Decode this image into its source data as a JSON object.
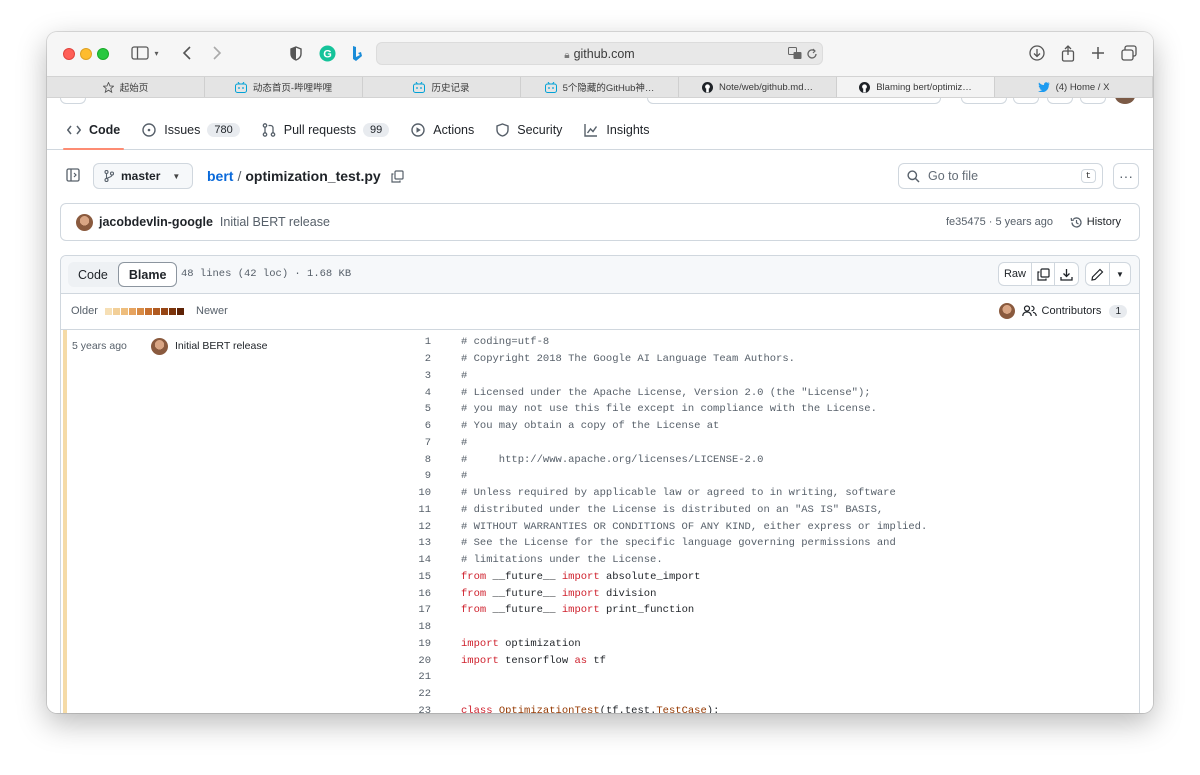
{
  "browser": {
    "url": "github.com",
    "tabs": [
      {
        "label": "起始页",
        "icon": "star-icon"
      },
      {
        "label": "动态首页-哔哩哔哩",
        "icon": "bilibili-icon"
      },
      {
        "label": "历史记录",
        "icon": "bilibili-icon"
      },
      {
        "label": "5个隐藏的GitHub神…",
        "icon": "bilibili-icon"
      },
      {
        "label": "Note/web/github.md…",
        "icon": "github-icon"
      },
      {
        "label": "Blaming bert/optimiz…",
        "icon": "github-icon"
      },
      {
        "label": "(4) Home / X",
        "icon": "twitter-icon"
      }
    ],
    "active_tab": 5
  },
  "repo_nav": {
    "items": [
      {
        "label": "Code",
        "icon": "code-icon"
      },
      {
        "label": "Issues",
        "icon": "issue-icon",
        "count": "780"
      },
      {
        "label": "Pull requests",
        "icon": "pull-request-icon",
        "count": "99"
      },
      {
        "label": "Actions",
        "icon": "play-icon"
      },
      {
        "label": "Security",
        "icon": "shield-icon"
      },
      {
        "label": "Insights",
        "icon": "graph-icon"
      }
    ]
  },
  "file_header": {
    "branch": "master",
    "repo": "bert",
    "separator": "/",
    "file": "optimization_test.py",
    "goto_placeholder": "Go to file",
    "goto_shortcut": "t"
  },
  "commit": {
    "author": "jacobdevlin-google",
    "message": "Initial BERT release",
    "meta": "fe35475 · 5 years ago",
    "history_label": "History"
  },
  "blame": {
    "tab_code": "Code",
    "tab_blame": "Blame",
    "file_info": "48 lines (42 loc) · 1.68 KB",
    "raw_label": "Raw",
    "older_label": "Older",
    "newer_label": "Newer",
    "contributors_label": "Contributors",
    "contributors_count": "1",
    "age_colors": [
      "#f6dfb5",
      "#f2cf98",
      "#eebd7c",
      "#e6a35f",
      "#d88b45",
      "#c7702f",
      "#b05a20",
      "#964514",
      "#7b330b",
      "#5e2205"
    ],
    "group": {
      "age": "5 years ago",
      "message": "Initial BERT release"
    }
  },
  "code_lines": [
    {
      "n": "1",
      "tokens": [
        {
          "t": "# coding=utf-8",
          "c": "c"
        }
      ]
    },
    {
      "n": "2",
      "tokens": [
        {
          "t": "# Copyright 2018 The Google AI Language Team Authors.",
          "c": "c"
        }
      ]
    },
    {
      "n": "3",
      "tokens": [
        {
          "t": "#",
          "c": "c"
        }
      ]
    },
    {
      "n": "4",
      "tokens": [
        {
          "t": "# Licensed under the Apache License, Version 2.0 (the \"License\");",
          "c": "c"
        }
      ]
    },
    {
      "n": "5",
      "tokens": [
        {
          "t": "# you may not use this file except in compliance with the License.",
          "c": "c"
        }
      ]
    },
    {
      "n": "6",
      "tokens": [
        {
          "t": "# You may obtain a copy of the License at",
          "c": "c"
        }
      ]
    },
    {
      "n": "7",
      "tokens": [
        {
          "t": "#",
          "c": "c"
        }
      ]
    },
    {
      "n": "8",
      "tokens": [
        {
          "t": "#     http://www.apache.org/licenses/LICENSE-2.0",
          "c": "c"
        }
      ]
    },
    {
      "n": "9",
      "tokens": [
        {
          "t": "#",
          "c": "c"
        }
      ]
    },
    {
      "n": "10",
      "tokens": [
        {
          "t": "# Unless required by applicable law or agreed to in writing, software",
          "c": "c"
        }
      ]
    },
    {
      "n": "11",
      "tokens": [
        {
          "t": "# distributed under the License is distributed on an \"AS IS\" BASIS,",
          "c": "c"
        }
      ]
    },
    {
      "n": "12",
      "tokens": [
        {
          "t": "# WITHOUT WARRANTIES OR CONDITIONS OF ANY KIND, either express or implied.",
          "c": "c"
        }
      ]
    },
    {
      "n": "13",
      "tokens": [
        {
          "t": "# See the License for the specific language governing permissions and",
          "c": "c"
        }
      ]
    },
    {
      "n": "14",
      "tokens": [
        {
          "t": "# limitations under the License.",
          "c": "c"
        }
      ]
    },
    {
      "n": "15",
      "tokens": [
        {
          "t": "from",
          "c": "k"
        },
        {
          "t": " __future__ ",
          "c": ""
        },
        {
          "t": "import",
          "c": "k"
        },
        {
          "t": " absolute_import",
          "c": ""
        }
      ]
    },
    {
      "n": "16",
      "tokens": [
        {
          "t": "from",
          "c": "k"
        },
        {
          "t": " __future__ ",
          "c": ""
        },
        {
          "t": "import",
          "c": "k"
        },
        {
          "t": " division",
          "c": ""
        }
      ]
    },
    {
      "n": "17",
      "tokens": [
        {
          "t": "from",
          "c": "k"
        },
        {
          "t": " __future__ ",
          "c": ""
        },
        {
          "t": "import",
          "c": "k"
        },
        {
          "t": " print_function",
          "c": ""
        }
      ]
    },
    {
      "n": "18",
      "tokens": []
    },
    {
      "n": "19",
      "tokens": [
        {
          "t": "import",
          "c": "k"
        },
        {
          "t": " optimization",
          "c": ""
        }
      ]
    },
    {
      "n": "20",
      "tokens": [
        {
          "t": "import",
          "c": "k"
        },
        {
          "t": " tensorflow ",
          "c": ""
        },
        {
          "t": "as",
          "c": "k"
        },
        {
          "t": " tf",
          "c": ""
        }
      ]
    },
    {
      "n": "21",
      "tokens": []
    },
    {
      "n": "22",
      "tokens": []
    },
    {
      "n": "23",
      "tokens": [
        {
          "t": "class",
          "c": "k"
        },
        {
          "t": " ",
          "c": ""
        },
        {
          "t": "OptimizationTest",
          "c": "t"
        },
        {
          "t": "(tf.test.",
          "c": ""
        },
        {
          "t": "TestCase",
          "c": "t"
        },
        {
          "t": "):",
          "c": ""
        }
      ]
    }
  ]
}
